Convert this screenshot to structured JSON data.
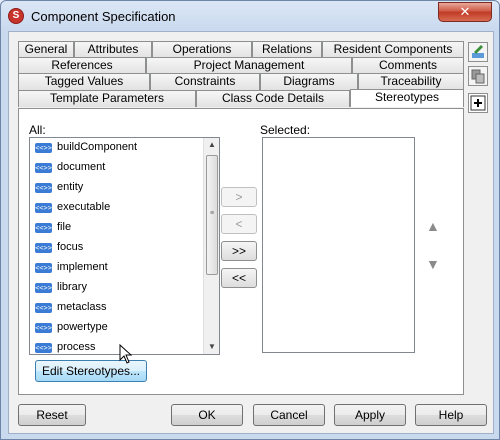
{
  "window": {
    "title": "Component Specification",
    "close_label": "✕",
    "app_icon_label": "S"
  },
  "tabs": {
    "row1": [
      "General",
      "Attributes",
      "Operations",
      "Relations",
      "Resident Components"
    ],
    "row2": [
      "References",
      "Project Management",
      "Comments"
    ],
    "row3": [
      "Tagged Values",
      "Constraints",
      "Diagrams",
      "Traceability"
    ],
    "row4": [
      "Template Parameters",
      "Class Code Details",
      "Stereotypes"
    ],
    "active": "Stereotypes"
  },
  "stereotypes": {
    "all_label": "All:",
    "selected_label": "Selected:",
    "icon_label": "<<>>",
    "items": [
      "buildComponent",
      "document",
      "entity",
      "executable",
      "file",
      "focus",
      "implement",
      "library",
      "metaclass",
      "powertype",
      "process"
    ],
    "add_label": ">",
    "remove_label": "<",
    "add_all_label": ">>",
    "remove_all_label": "<<",
    "move_up_label": "▲",
    "move_down_label": "▼",
    "edit_button": "Edit Stereotypes..."
  },
  "footer": {
    "reset": "Reset",
    "ok": "OK",
    "cancel": "Cancel",
    "apply": "Apply",
    "help": "Help"
  },
  "colors": {
    "title_bg": "#c9d9ee",
    "close": "#c03a24",
    "stereotype_icon": "#3a7bd5"
  }
}
